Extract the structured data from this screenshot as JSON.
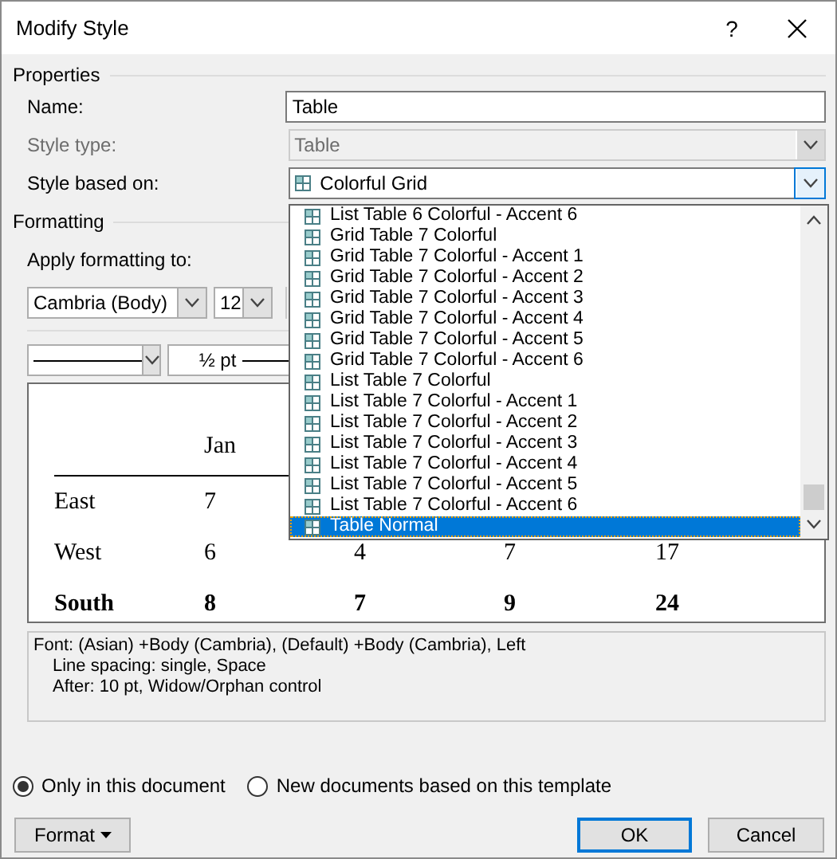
{
  "window": {
    "title": "Modify Style",
    "help": "?"
  },
  "properties": {
    "heading": "Properties",
    "fields": [
      {
        "label": "Name:",
        "kind": "input",
        "value": "Table",
        "disabled": false
      },
      {
        "label": "Style type:",
        "kind": "combo",
        "value": "Table",
        "disabled": true
      },
      {
        "label": "Style based on:",
        "kind": "combo",
        "value": "Colorful Grid",
        "disabled": false,
        "expanded": true
      }
    ]
  },
  "dropdown": {
    "items": [
      {
        "label": "List Table 6 Colorful - Accent 6",
        "selected": false
      },
      {
        "label": "Grid Table 7 Colorful",
        "selected": false
      },
      {
        "label": "Grid Table 7 Colorful - Accent 1",
        "selected": false
      },
      {
        "label": "Grid Table 7 Colorful - Accent 2",
        "selected": false
      },
      {
        "label": "Grid Table 7 Colorful - Accent 3",
        "selected": false
      },
      {
        "label": "Grid Table 7 Colorful - Accent 4",
        "selected": false
      },
      {
        "label": "Grid Table 7 Colorful - Accent 5",
        "selected": false
      },
      {
        "label": "Grid Table 7 Colorful - Accent 6",
        "selected": false
      },
      {
        "label": "List Table 7 Colorful",
        "selected": false
      },
      {
        "label": "List Table 7 Colorful - Accent 1",
        "selected": false
      },
      {
        "label": "List Table 7 Colorful - Accent 2",
        "selected": false
      },
      {
        "label": "List Table 7 Colorful - Accent 3",
        "selected": false
      },
      {
        "label": "List Table 7 Colorful - Accent 4",
        "selected": false
      },
      {
        "label": "List Table 7 Colorful - Accent 5",
        "selected": false
      },
      {
        "label": "List Table 7 Colorful - Accent 6",
        "selected": false
      },
      {
        "label": "Table Normal",
        "selected": true
      }
    ]
  },
  "formatting": {
    "heading": "Formatting",
    "apply_label": "Apply formatting to:",
    "font": "Cambria (Body)",
    "size": "12",
    "border_width": "½ pt"
  },
  "preview": {
    "header": [
      "Jan"
    ],
    "rows": [
      {
        "label": "East",
        "bold": false,
        "cells": [
          "7"
        ]
      },
      {
        "label": "West",
        "bold": false,
        "cells": [
          "6",
          "4",
          "7",
          "17"
        ]
      },
      {
        "label": "South",
        "bold": true,
        "cells": [
          "8",
          "7",
          "9",
          "24"
        ]
      }
    ]
  },
  "description": [
    "Font: (Asian) +Body (Cambria), (Default) +Body (Cambria), Left",
    "Line spacing:  single, Space",
    "After:  10 pt, Widow/Orphan control"
  ],
  "scope": [
    {
      "label": "Only in this document",
      "selected": true
    },
    {
      "label": "New documents based on this template",
      "selected": false
    }
  ],
  "buttons": [
    {
      "label": "Format",
      "kind": "menu"
    },
    {
      "label": "OK",
      "kind": "default"
    },
    {
      "label": "Cancel",
      "kind": "plain"
    }
  ]
}
